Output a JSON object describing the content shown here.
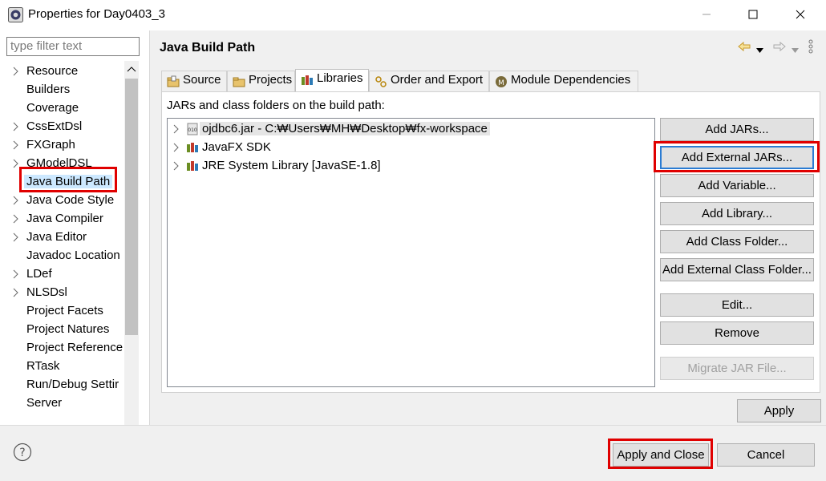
{
  "window": {
    "title": "Properties for Day0403_3",
    "icon": "eclipse-gear-icon"
  },
  "sidebar": {
    "filter_placeholder": "type filter text",
    "items": [
      {
        "label": "Resource",
        "expandable": true
      },
      {
        "label": "Builders",
        "expandable": false
      },
      {
        "label": "Coverage",
        "expandable": false
      },
      {
        "label": "CssExtDsl",
        "expandable": true
      },
      {
        "label": "FXGraph",
        "expandable": true
      },
      {
        "label": "GModelDSL",
        "expandable": true
      },
      {
        "label": "Java Build Path",
        "expandable": false,
        "selected": true
      },
      {
        "label": "Java Code Style",
        "expandable": true
      },
      {
        "label": "Java Compiler",
        "expandable": true
      },
      {
        "label": "Java Editor",
        "expandable": true
      },
      {
        "label": "Javadoc Location",
        "expandable": false
      },
      {
        "label": "LDef",
        "expandable": true
      },
      {
        "label": "NLSDsl",
        "expandable": true
      },
      {
        "label": "Project Facets",
        "expandable": false
      },
      {
        "label": "Project Natures",
        "expandable": false
      },
      {
        "label": "Project Reference",
        "expandable": false
      },
      {
        "label": "RTask",
        "expandable": false
      },
      {
        "label": "Run/Debug Settir",
        "expandable": false
      },
      {
        "label": "Server",
        "expandable": false
      }
    ]
  },
  "main": {
    "title": "Java Build Path",
    "tabs": [
      {
        "label": "Source",
        "icon": "source-folder-icon"
      },
      {
        "label": "Projects",
        "icon": "projects-folder-icon"
      },
      {
        "label": "Libraries",
        "icon": "library-icon",
        "active": true
      },
      {
        "label": "Order and Export",
        "icon": "order-export-icon"
      },
      {
        "label": "Module Dependencies",
        "icon": "module-icon"
      }
    ],
    "panel_label": "JARs and class folders on the build path:",
    "libraries": [
      {
        "label": "ojdbc6.jar - C:₩Users₩MH₩Desktop₩fx-workspace",
        "icon": "jar-file-icon",
        "selected": true
      },
      {
        "label": "JavaFX SDK",
        "icon": "library-icon"
      },
      {
        "label": "JRE System Library [JavaSE-1.8]",
        "icon": "library-icon"
      }
    ],
    "buttons": {
      "add_jars": "Add JARs...",
      "add_external_jars": "Add External JARs...",
      "add_variable": "Add Variable...",
      "add_library": "Add Library...",
      "add_class_folder": "Add Class Folder...",
      "add_external_class_folder": "Add External Class Folder...",
      "edit": "Edit...",
      "remove": "Remove",
      "migrate_jar": "Migrate JAR File..."
    },
    "apply": "Apply"
  },
  "footer": {
    "apply_and_close": "Apply and Close",
    "cancel": "Cancel"
  },
  "colors": {
    "highlight_red": "#e00000",
    "selection": "#cce8ff",
    "focus_blue": "#2b7cd3"
  }
}
